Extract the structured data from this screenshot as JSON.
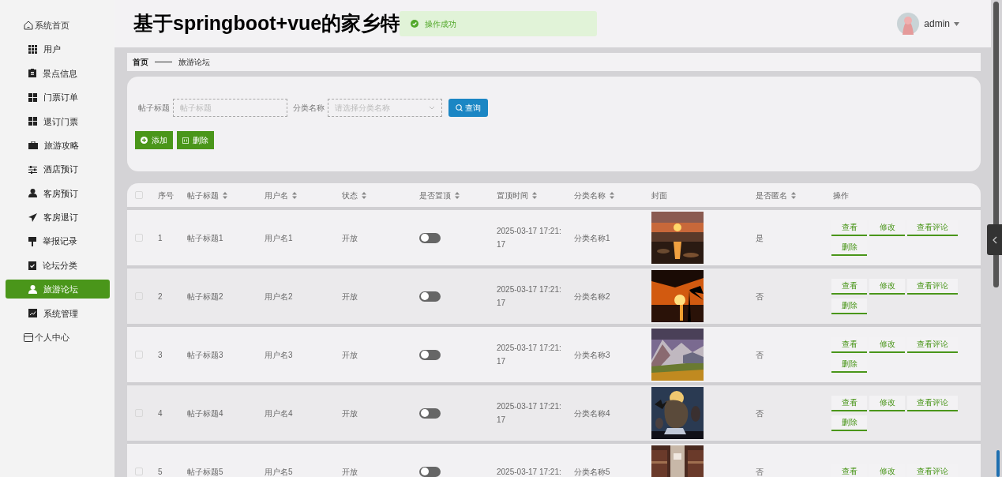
{
  "header": {
    "title": "基于springboot+vue的家乡特",
    "user": "admin"
  },
  "toast": {
    "message": "操作成功"
  },
  "sidebar": {
    "items": [
      {
        "label": "系统首页",
        "kind": "top",
        "selected": false
      },
      {
        "label": "用户",
        "kind": "menu",
        "selected": false
      },
      {
        "label": "景点信息",
        "kind": "menu",
        "selected": false
      },
      {
        "label": "门票订单",
        "kind": "menu",
        "selected": false
      },
      {
        "label": "退订门票",
        "kind": "menu",
        "selected": false
      },
      {
        "label": "旅游攻略",
        "kind": "menu",
        "selected": false
      },
      {
        "label": "酒店预订",
        "kind": "menu",
        "selected": false
      },
      {
        "label": "客房预订",
        "kind": "menu",
        "selected": false
      },
      {
        "label": "客房退订",
        "kind": "menu",
        "selected": false
      },
      {
        "label": "举报记录",
        "kind": "menu",
        "selected": false
      },
      {
        "label": "论坛分类",
        "kind": "menu",
        "selected": false
      },
      {
        "label": "旅游论坛",
        "kind": "menu",
        "selected": true
      },
      {
        "label": "系统管理",
        "kind": "menu",
        "selected": false
      },
      {
        "label": "个人中心",
        "kind": "top",
        "selected": false
      }
    ]
  },
  "breadcrumb": [
    "首页",
    "旅游论坛"
  ],
  "search": {
    "fields": [
      {
        "label": "帖子标题",
        "placeholder": "帖子标题",
        "kind": "text"
      },
      {
        "label": "分类名称",
        "placeholder": "请选择分类名称",
        "kind": "select"
      }
    ],
    "button": "查询"
  },
  "toolbar": [
    {
      "label": "添加",
      "kind": "add"
    },
    {
      "label": "删除",
      "kind": "delete"
    }
  ],
  "table": {
    "select_all_checked": false,
    "columns": [
      {
        "label": "序号",
        "sortable": false
      },
      {
        "label": "帖子标题",
        "sortable": true
      },
      {
        "label": "用户名",
        "sortable": true
      },
      {
        "label": "状态",
        "sortable": true
      },
      {
        "label": "是否置顶",
        "sortable": true
      },
      {
        "label": "置顶时间",
        "sortable": true
      },
      {
        "label": "分类名称",
        "sortable": true
      },
      {
        "label": "封面",
        "sortable": false
      },
      {
        "label": "是否匿名",
        "sortable": true
      },
      {
        "label": "操作",
        "sortable": false
      }
    ],
    "rows": [
      {
        "checked": false,
        "index": "1",
        "title": "帖子标题1",
        "user": "用户名1",
        "status": "开放",
        "pinned": false,
        "pin_time": "2025-03-17 17:21:17",
        "category": "分类名称1",
        "cover": {
          "kind": "picture"
        },
        "anonymous": "是",
        "actions": [
          "查看",
          "修改",
          "查看评论",
          "删除"
        ]
      },
      {
        "checked": false,
        "index": "2",
        "title": "帖子标题2",
        "user": "用户名2",
        "status": "开放",
        "pinned": false,
        "pin_time": "2025-03-17 17:21:17",
        "category": "分类名称2",
        "cover": {
          "kind": "picture"
        },
        "anonymous": "否",
        "actions": [
          "查看",
          "修改",
          "查看评论",
          "删除"
        ]
      },
      {
        "checked": false,
        "index": "3",
        "title": "帖子标题3",
        "user": "用户名3",
        "status": "开放",
        "pinned": false,
        "pin_time": "2025-03-17 17:21:17",
        "category": "分类名称3",
        "cover": {
          "kind": "picture"
        },
        "anonymous": "否",
        "actions": [
          "查看",
          "修改",
          "查看评论",
          "删除"
        ]
      },
      {
        "checked": false,
        "index": "4",
        "title": "帖子标题4",
        "user": "用户名4",
        "status": "开放",
        "pinned": false,
        "pin_time": "2025-03-17 17:21:17",
        "category": "分类名称4",
        "cover": {
          "kind": "picture"
        },
        "anonymous": "否",
        "actions": [
          "查看",
          "修改",
          "查看评论",
          "删除"
        ]
      },
      {
        "checked": false,
        "index": "5",
        "title": "帖子标题5",
        "user": "用户名5",
        "status": "开放",
        "pinned": false,
        "pin_time": "2025-03-17 17:21:",
        "category": "分类名称5",
        "cover": {
          "kind": "picture"
        },
        "anonymous": "否",
        "actions": [
          "查看",
          "修改",
          "查看评论"
        ]
      }
    ]
  }
}
